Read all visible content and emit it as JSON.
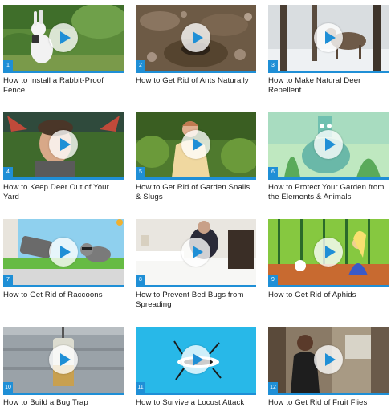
{
  "accent_color": "#1f8fd6",
  "videos": [
    {
      "number": "1",
      "title": "How to Install a Rabbit-Proof Fence",
      "thumb_icon": "rabbit-thumbnail"
    },
    {
      "number": "2",
      "title": "How to Get Rid of Ants Naturally",
      "thumb_icon": "ant-hill-thumbnail"
    },
    {
      "number": "3",
      "title": "How to Make Natural Deer Repellent",
      "thumb_icon": "deer-in-snow-thumbnail"
    },
    {
      "number": "4",
      "title": "How to Keep Deer Out of Your Yard",
      "thumb_icon": "man-with-antlers-thumbnail"
    },
    {
      "number": "5",
      "title": "How to Get Rid of Garden Snails & Slugs",
      "thumb_icon": "woman-in-garden-thumbnail"
    },
    {
      "number": "6",
      "title": "How to Protect Your Garden from the Elements & Animals",
      "thumb_icon": "cartoon-bird-thumbnail"
    },
    {
      "number": "7",
      "title": "How to Get Rid of Raccoons",
      "thumb_icon": "cartoon-raccoon-thumbnail"
    },
    {
      "number": "8",
      "title": "How to Prevent Bed Bugs from Spreading",
      "thumb_icon": "bedroom-thumbnail"
    },
    {
      "number": "9",
      "title": "How to Get Rid of Aphids",
      "thumb_icon": "cartoon-garden-thumbnail"
    },
    {
      "number": "10",
      "title": "How to Build a Bug Trap",
      "thumb_icon": "bug-trap-thumbnail"
    },
    {
      "number": "11",
      "title": "How to Survive a Locust Attack",
      "thumb_icon": "locust-thumbnail"
    },
    {
      "number": "12",
      "title": "How to Get Rid of Fruit Flies",
      "thumb_icon": "man-in-kitchen-thumbnail"
    }
  ],
  "play_icon": "play-icon"
}
